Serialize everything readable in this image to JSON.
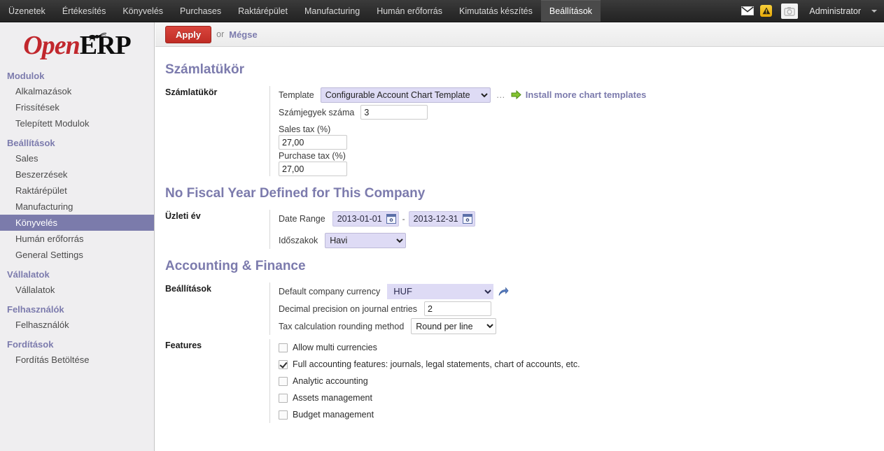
{
  "topmenu": {
    "items": [
      {
        "label": "Üzenetek",
        "active": false
      },
      {
        "label": "Értékesítés",
        "active": false
      },
      {
        "label": "Könyvelés",
        "active": false
      },
      {
        "label": "Purchases",
        "active": false
      },
      {
        "label": "Raktárépület",
        "active": false
      },
      {
        "label": "Manufacturing",
        "active": false
      },
      {
        "label": "Humán erőforrás",
        "active": false
      },
      {
        "label": "Kimutatás készítés",
        "active": false
      },
      {
        "label": "Beállítások",
        "active": true
      }
    ],
    "mail_icon": "envelope-icon",
    "warning_icon": "warning-triangle-icon",
    "avatar_icon": "avatar-placeholder-icon",
    "user": "Administrator"
  },
  "sidebar": {
    "logo_part1": "Open",
    "logo_part2": "ERP",
    "groups": [
      {
        "title": "Modulok",
        "items": [
          {
            "label": "Alkalmazások",
            "selected": false
          },
          {
            "label": "Frissítések",
            "selected": false
          },
          {
            "label": "Telepített Modulok",
            "selected": false
          }
        ]
      },
      {
        "title": "Beállítások",
        "items": [
          {
            "label": "Sales",
            "selected": false
          },
          {
            "label": "Beszerzések",
            "selected": false
          },
          {
            "label": "Raktárépület",
            "selected": false
          },
          {
            "label": "Manufacturing",
            "selected": false
          },
          {
            "label": "Könyvelés",
            "selected": true
          },
          {
            "label": "Humán erőforrás",
            "selected": false
          },
          {
            "label": "General Settings",
            "selected": false
          }
        ]
      },
      {
        "title": "Vállalatok",
        "items": [
          {
            "label": "Vállalatok",
            "selected": false
          }
        ]
      },
      {
        "title": "Felhasználók",
        "items": [
          {
            "label": "Felhasználók",
            "selected": false
          }
        ]
      },
      {
        "title": "Fordítások",
        "items": [
          {
            "label": "Fordítás Betöltése",
            "selected": false
          }
        ]
      }
    ]
  },
  "actionbar": {
    "apply_label": "Apply",
    "or_label": "or",
    "cancel_label": "Mégse"
  },
  "sections": {
    "chart_of_accounts": {
      "heading": "Számlatükör",
      "row_label": "Számlatükör",
      "template_label": "Template",
      "template_value": "Configurable Account Chart Template",
      "template_options": [
        "Configurable Account Chart Template"
      ],
      "separator": "…",
      "install_link": "Install more chart templates",
      "install_icon": "green-arrow-icon",
      "digits_label": "Számjegyek száma",
      "digits_value": "3",
      "sales_tax_label": "Sales tax (%)",
      "sales_tax_value": "27,00",
      "purchase_tax_label": "Purchase tax (%)",
      "purchase_tax_value": "27,00"
    },
    "fiscal_year": {
      "heading": "No Fiscal Year Defined for This Company",
      "row_label": "Üzleti év",
      "date_range_label": "Date Range",
      "date_from": "2013-01-01",
      "date_to": "2013-12-31",
      "date_separator": "-",
      "calendar_icon": "calendar-icon",
      "periods_label": "Időszakok",
      "periods_value": "Havi",
      "periods_options": [
        "Havi"
      ]
    },
    "accounting_finance": {
      "heading": "Accounting & Finance",
      "settings_row_label": "Beállítások",
      "currency_label": "Default company currency",
      "currency_value": "HUF",
      "currency_options": [
        "HUF"
      ],
      "currency_ext_icon": "external-link-icon",
      "decimal_label": "Decimal precision on journal entries",
      "decimal_value": "2",
      "rounding_label": "Tax calculation rounding method",
      "rounding_value": "Round per line",
      "rounding_options": [
        "Round per line"
      ],
      "features_row_label": "Features",
      "features": [
        {
          "label": "Allow multi currencies",
          "checked": false
        },
        {
          "label": "Full accounting features: journals, legal statements, chart of accounts, etc.",
          "checked": true
        },
        {
          "label": "Analytic accounting",
          "checked": false
        },
        {
          "label": "Assets management",
          "checked": false
        },
        {
          "label": "Budget management",
          "checked": false
        }
      ]
    }
  },
  "colors": {
    "accent_purple": "#7c7bad",
    "apply_red": "#c02d26",
    "sidebar_bg": "#efeef0",
    "field_purple": "#dedbf5",
    "topbar_dark": "#2e2e2e"
  }
}
